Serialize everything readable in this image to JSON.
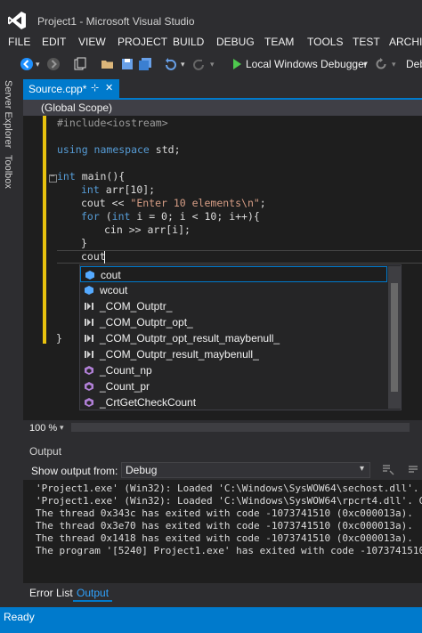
{
  "window": {
    "title": "Project1 - Microsoft Visual Studio"
  },
  "menu": [
    "FILE",
    "EDIT",
    "VIEW",
    "PROJECT",
    "BUILD",
    "DEBUG",
    "TEAM",
    "TOOLS",
    "TEST",
    "ARCHI"
  ],
  "toolbar": {
    "debugger_label": "Local Windows Debugger",
    "debugger_cut": "Deb"
  },
  "left_tabs": [
    "Server Explorer",
    "Toolbox"
  ],
  "doc_tab": {
    "label": "Source.cpp*",
    "pin": "⊹",
    "close": "✕"
  },
  "scope": "(Global Scope)",
  "code": {
    "l1": "#include<iostream>",
    "l2a": "using",
    "l2b": " namespace",
    "l2c": " std;",
    "l3a": "int",
    "l3b": " main(){",
    "l4a": "int",
    "l4b": " arr[10];",
    "l5a": "cout << ",
    "l5b": "\"Enter 10 elements\\n\"",
    "l5c": ";",
    "l6a": "for",
    "l6b": " (",
    "l6c": "int",
    "l6d": " i = 0; i < 10; i++){",
    "l7": "cin >> arr[i];",
    "l8": "}",
    "l9": "cout",
    "l10": "}"
  },
  "completion": [
    {
      "label": "cout",
      "kind": "variable"
    },
    {
      "label": "wcout",
      "kind": "variable"
    },
    {
      "label": "_COM_Outptr_",
      "kind": "macro"
    },
    {
      "label": "_COM_Outptr_opt_",
      "kind": "macro"
    },
    {
      "label": "_COM_Outptr_opt_result_maybenull_",
      "kind": "macro"
    },
    {
      "label": "_COM_Outptr_result_maybenull_",
      "kind": "macro"
    },
    {
      "label": "_Count_np",
      "kind": "function"
    },
    {
      "label": "_Count_pr",
      "kind": "function"
    },
    {
      "label": "_CrtGetCheckCount",
      "kind": "function"
    }
  ],
  "zoom": "100 %",
  "output": {
    "title": "Output",
    "show_from_label": "Show output from:",
    "source": "Debug",
    "lines": [
      "'Project1.exe' (Win32): Loaded 'C:\\Windows\\SysWOW64\\sechost.dll'. C",
      "'Project1.exe' (Win32): Loaded 'C:\\Windows\\SysWOW64\\rpcrt4.dll'. C",
      "The thread 0x343c has exited with code -1073741510 (0xc000013a).",
      "The thread 0x3e70 has exited with code -1073741510 (0xc000013a).",
      "The thread 0x1418 has exited with code -1073741510 (0xc000013a).",
      "The program '[5240] Project1.exe' has exited with code -1073741510"
    ]
  },
  "bottom_tabs": {
    "error_list": "Error List",
    "output": "Output"
  },
  "status": "Ready",
  "colors": {
    "accent": "#007acc",
    "background": "#2d2d30",
    "editor": "#1e1e1e",
    "change_bar": "#e8c20e"
  }
}
